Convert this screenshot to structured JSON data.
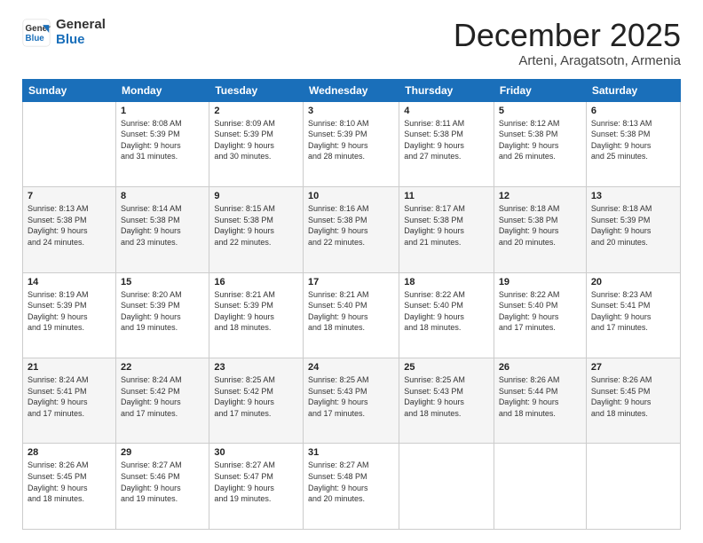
{
  "header": {
    "logo_line1": "General",
    "logo_line2": "Blue",
    "month": "December 2025",
    "location": "Arteni, Aragatsotn, Armenia"
  },
  "weekdays": [
    "Sunday",
    "Monday",
    "Tuesday",
    "Wednesday",
    "Thursday",
    "Friday",
    "Saturday"
  ],
  "weeks": [
    [
      {
        "day": "",
        "info": ""
      },
      {
        "day": "1",
        "info": "Sunrise: 8:08 AM\nSunset: 5:39 PM\nDaylight: 9 hours\nand 31 minutes."
      },
      {
        "day": "2",
        "info": "Sunrise: 8:09 AM\nSunset: 5:39 PM\nDaylight: 9 hours\nand 30 minutes."
      },
      {
        "day": "3",
        "info": "Sunrise: 8:10 AM\nSunset: 5:39 PM\nDaylight: 9 hours\nand 28 minutes."
      },
      {
        "day": "4",
        "info": "Sunrise: 8:11 AM\nSunset: 5:38 PM\nDaylight: 9 hours\nand 27 minutes."
      },
      {
        "day": "5",
        "info": "Sunrise: 8:12 AM\nSunset: 5:38 PM\nDaylight: 9 hours\nand 26 minutes."
      },
      {
        "day": "6",
        "info": "Sunrise: 8:13 AM\nSunset: 5:38 PM\nDaylight: 9 hours\nand 25 minutes."
      }
    ],
    [
      {
        "day": "7",
        "info": "Sunrise: 8:13 AM\nSunset: 5:38 PM\nDaylight: 9 hours\nand 24 minutes."
      },
      {
        "day": "8",
        "info": "Sunrise: 8:14 AM\nSunset: 5:38 PM\nDaylight: 9 hours\nand 23 minutes."
      },
      {
        "day": "9",
        "info": "Sunrise: 8:15 AM\nSunset: 5:38 PM\nDaylight: 9 hours\nand 22 minutes."
      },
      {
        "day": "10",
        "info": "Sunrise: 8:16 AM\nSunset: 5:38 PM\nDaylight: 9 hours\nand 22 minutes."
      },
      {
        "day": "11",
        "info": "Sunrise: 8:17 AM\nSunset: 5:38 PM\nDaylight: 9 hours\nand 21 minutes."
      },
      {
        "day": "12",
        "info": "Sunrise: 8:18 AM\nSunset: 5:38 PM\nDaylight: 9 hours\nand 20 minutes."
      },
      {
        "day": "13",
        "info": "Sunrise: 8:18 AM\nSunset: 5:39 PM\nDaylight: 9 hours\nand 20 minutes."
      }
    ],
    [
      {
        "day": "14",
        "info": "Sunrise: 8:19 AM\nSunset: 5:39 PM\nDaylight: 9 hours\nand 19 minutes."
      },
      {
        "day": "15",
        "info": "Sunrise: 8:20 AM\nSunset: 5:39 PM\nDaylight: 9 hours\nand 19 minutes."
      },
      {
        "day": "16",
        "info": "Sunrise: 8:21 AM\nSunset: 5:39 PM\nDaylight: 9 hours\nand 18 minutes."
      },
      {
        "day": "17",
        "info": "Sunrise: 8:21 AM\nSunset: 5:40 PM\nDaylight: 9 hours\nand 18 minutes."
      },
      {
        "day": "18",
        "info": "Sunrise: 8:22 AM\nSunset: 5:40 PM\nDaylight: 9 hours\nand 18 minutes."
      },
      {
        "day": "19",
        "info": "Sunrise: 8:22 AM\nSunset: 5:40 PM\nDaylight: 9 hours\nand 17 minutes."
      },
      {
        "day": "20",
        "info": "Sunrise: 8:23 AM\nSunset: 5:41 PM\nDaylight: 9 hours\nand 17 minutes."
      }
    ],
    [
      {
        "day": "21",
        "info": "Sunrise: 8:24 AM\nSunset: 5:41 PM\nDaylight: 9 hours\nand 17 minutes."
      },
      {
        "day": "22",
        "info": "Sunrise: 8:24 AM\nSunset: 5:42 PM\nDaylight: 9 hours\nand 17 minutes."
      },
      {
        "day": "23",
        "info": "Sunrise: 8:25 AM\nSunset: 5:42 PM\nDaylight: 9 hours\nand 17 minutes."
      },
      {
        "day": "24",
        "info": "Sunrise: 8:25 AM\nSunset: 5:43 PM\nDaylight: 9 hours\nand 17 minutes."
      },
      {
        "day": "25",
        "info": "Sunrise: 8:25 AM\nSunset: 5:43 PM\nDaylight: 9 hours\nand 18 minutes."
      },
      {
        "day": "26",
        "info": "Sunrise: 8:26 AM\nSunset: 5:44 PM\nDaylight: 9 hours\nand 18 minutes."
      },
      {
        "day": "27",
        "info": "Sunrise: 8:26 AM\nSunset: 5:45 PM\nDaylight: 9 hours\nand 18 minutes."
      }
    ],
    [
      {
        "day": "28",
        "info": "Sunrise: 8:26 AM\nSunset: 5:45 PM\nDaylight: 9 hours\nand 18 minutes."
      },
      {
        "day": "29",
        "info": "Sunrise: 8:27 AM\nSunset: 5:46 PM\nDaylight: 9 hours\nand 19 minutes."
      },
      {
        "day": "30",
        "info": "Sunrise: 8:27 AM\nSunset: 5:47 PM\nDaylight: 9 hours\nand 19 minutes."
      },
      {
        "day": "31",
        "info": "Sunrise: 8:27 AM\nSunset: 5:48 PM\nDaylight: 9 hours\nand 20 minutes."
      },
      {
        "day": "",
        "info": ""
      },
      {
        "day": "",
        "info": ""
      },
      {
        "day": "",
        "info": ""
      }
    ]
  ]
}
